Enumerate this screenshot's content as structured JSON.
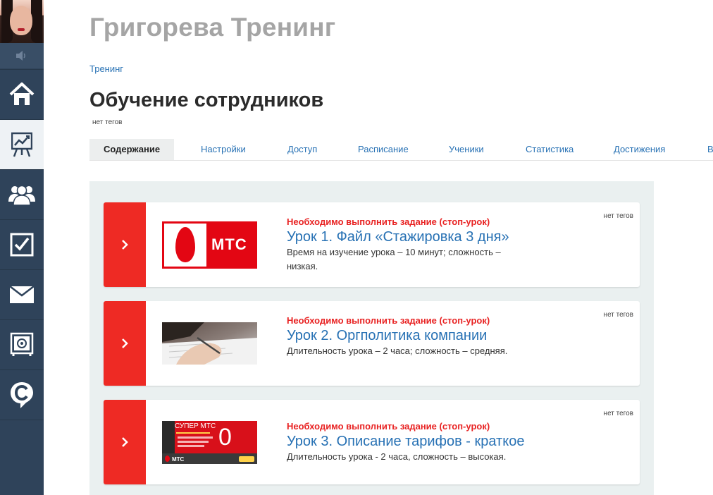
{
  "sidebar": {
    "sound_icon": "sound-icon",
    "items": [
      {
        "icon": "home-icon",
        "label": "home"
      },
      {
        "icon": "training-chart-icon",
        "label": "training"
      },
      {
        "icon": "users-icon",
        "label": "users"
      },
      {
        "icon": "checkbox-icon",
        "label": "tasks"
      },
      {
        "icon": "mail-icon",
        "label": "messages"
      },
      {
        "icon": "safe-icon",
        "label": "storage"
      },
      {
        "icon": "c-chat-icon",
        "label": "chat"
      }
    ],
    "active_index": 1
  },
  "header": {
    "site_title": "Григорева Тренинг",
    "breadcrumb": "Тренинг",
    "page_title": "Обучение сотрудников",
    "page_tags": "нет тегов"
  },
  "tabs": [
    {
      "label": "Содержание",
      "active": true
    },
    {
      "label": "Настройки"
    },
    {
      "label": "Доступ"
    },
    {
      "label": "Расписание"
    },
    {
      "label": "Ученики"
    },
    {
      "label": "Статистика"
    },
    {
      "label": "Достижения"
    },
    {
      "label": "В"
    }
  ],
  "lessons": [
    {
      "alert": "Необходимо выполнить задание (стоп-урок)",
      "title": "Урок 1. Файл «Стажировка 3 дня»",
      "desc": "Время на изучение урока – 10 минут; сложность – низкая.",
      "tags": "нет тегов",
      "thumb": {
        "type": "mts-logo",
        "text": "МТС"
      }
    },
    {
      "alert": "Необходимо выполнить задание (стоп-урок)",
      "title": "Урок 2. Оргполитика компании",
      "desc": "Длительность урока – 2 часа; сложность – средняя.",
      "tags": "нет тегов",
      "thumb": {
        "type": "hand-writing-photo"
      }
    },
    {
      "alert": "Необходимо выполнить задание (стоп-урок)",
      "title": "Урок 3. Описание тарифов - краткое",
      "desc": "Длительность урока - 2 часа, сложность – высокая.",
      "tags": "нет тегов",
      "thumb": {
        "type": "super-mts-banner",
        "heading": "СУПЕР МТС",
        "number": "0",
        "brand": "МТС"
      }
    }
  ],
  "colors": {
    "accent_red": "#ee2a24",
    "link_blue": "#2771b4",
    "sidebar_bg": "#2f435a",
    "panel_bg": "#eaf0f0"
  }
}
